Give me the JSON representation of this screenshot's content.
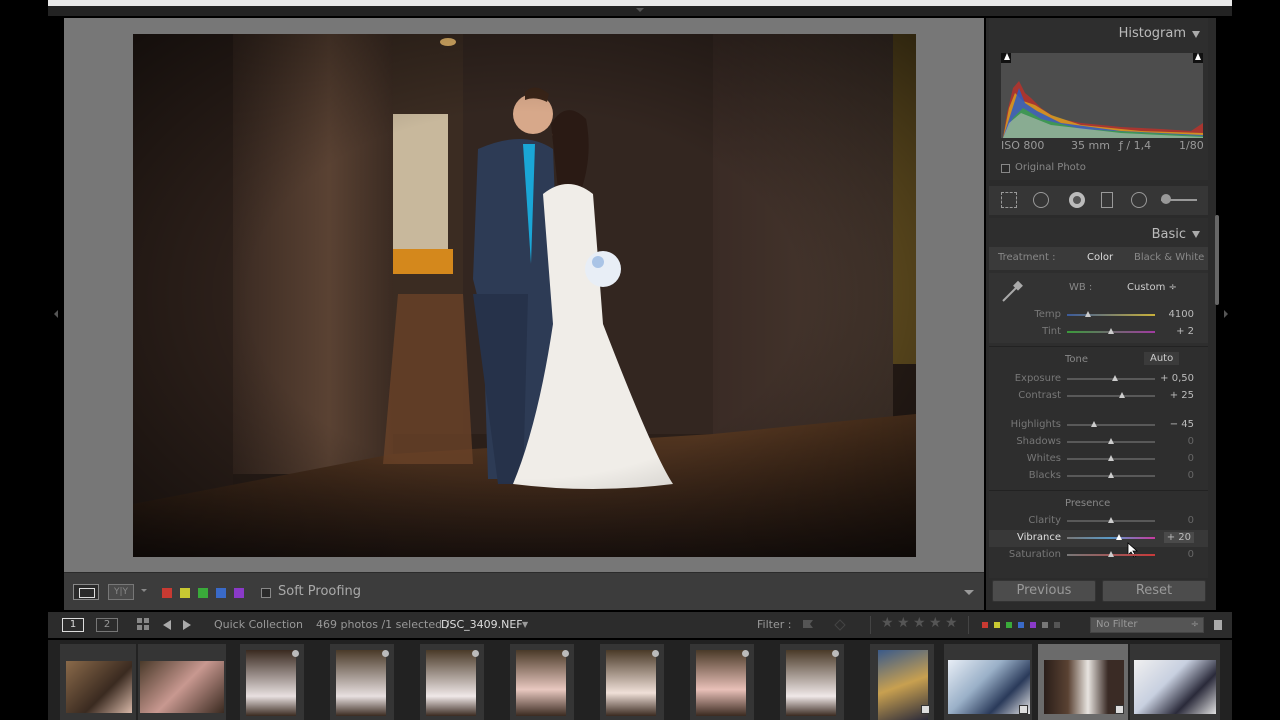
{
  "app": {
    "name": "Lightroom Develop"
  },
  "histogram": {
    "title": "Histogram",
    "iso": "ISO 800",
    "focal": "35 mm",
    "aperture": "ƒ / 1,4",
    "shutter": "1/80",
    "original_photo": "Original Photo"
  },
  "basic": {
    "title": "Basic",
    "treatment_label": "Treatment :",
    "treatment_color": "Color",
    "treatment_bw": "Black & White",
    "wb_label": "WB :",
    "wb_value": "Custom ÷",
    "tone_label": "Tone",
    "auto_label": "Auto",
    "presence_label": "Presence",
    "sliders": {
      "temp": {
        "label": "Temp",
        "value": "4100"
      },
      "tint": {
        "label": "Tint",
        "value": "+ 2"
      },
      "exposure": {
        "label": "Exposure",
        "value": "+ 0,50"
      },
      "contrast": {
        "label": "Contrast",
        "value": "+ 25"
      },
      "highlights": {
        "label": "Highlights",
        "value": "− 45"
      },
      "shadows": {
        "label": "Shadows",
        "value": "0"
      },
      "whites": {
        "label": "Whites",
        "value": "0"
      },
      "blacks": {
        "label": "Blacks",
        "value": "0"
      },
      "clarity": {
        "label": "Clarity",
        "value": "0"
      },
      "vibrance": {
        "label": "Vibrance",
        "value": "+ 20"
      },
      "saturation": {
        "label": "Saturation",
        "value": "0"
      }
    }
  },
  "buttons": {
    "previous": "Previous",
    "reset": "Reset"
  },
  "toolbar": {
    "yy": "Y|Y",
    "soft_proofing": "Soft Proofing",
    "swatches": [
      "#c83a32",
      "#c8c832",
      "#3aaa3a",
      "#3a6ac8",
      "#8a3ac8"
    ]
  },
  "filmbar": {
    "page1": "1",
    "page2": "2",
    "source": "Quick Collection",
    "count": "469 photos /1 selected /",
    "filename": "DSC_3409.NEF",
    "filter_label": "Filter :",
    "no_filter": "No Filter"
  },
  "stars": [
    "★",
    "★",
    "★",
    "★",
    "★"
  ],
  "labels_colors": [
    "#c83a32",
    "#c8c832",
    "#3aaa3a",
    "#3a6ac8",
    "#8a3ac8"
  ]
}
